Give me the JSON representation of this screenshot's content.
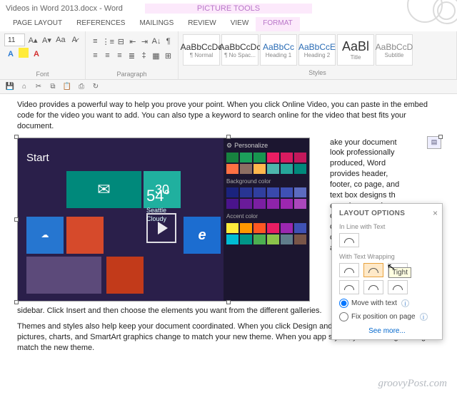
{
  "window": {
    "title": "Videos in Word 2013.docx - Word",
    "contextual_title": "PICTURE TOOLS"
  },
  "tabs": {
    "page_layout": "PAGE LAYOUT",
    "references": "REFERENCES",
    "mailings": "MAILINGS",
    "review": "REVIEW",
    "view": "VIEW",
    "format": "FORMAT"
  },
  "ribbon": {
    "font_size": "11",
    "group_font": "Font",
    "group_paragraph": "Paragraph",
    "group_styles": "Styles",
    "styles": [
      {
        "preview": "AaBbCcDc",
        "name": "¶ Normal"
      },
      {
        "preview": "AaBbCcDc",
        "name": "¶ No Spac..."
      },
      {
        "preview": "AaBbCc",
        "name": "Heading 1"
      },
      {
        "preview": "AaBbCcE",
        "name": "Heading 2"
      },
      {
        "preview": "AaBl",
        "name": "Title"
      },
      {
        "preview": "AaBbCcD",
        "name": "Subtitle"
      }
    ]
  },
  "doc": {
    "p1": "Video provides a powerful way to help you prove your point. When you click Online Video, you can paste in the embed code for the video you want to add. You can also type a keyword to search online for the video that best fits your document.",
    "wrap": "ake your document look professionally produced, Word provides header, footer, co page, and text box designs th compleme each othe For examp you can ac matching cover page header, an",
    "p2": "sidebar. Click Insert and then choose the elements you want from the different galleries.",
    "p3": "Themes and styles also help keep your document coordinated. When you click Design and choose a n Theme, the pictures, charts, and SmartArt graphics change to match your new theme. When you app styles, your headings change to match the new theme."
  },
  "media": {
    "start": "Start",
    "personalize": "Personalize",
    "temp": "54°",
    "city": "Seattle",
    "cond": "Cloudy",
    "date": "30"
  },
  "layout": {
    "title": "LAYOUT OPTIONS",
    "inline": "In Line with Text",
    "wrapping": "With Text Wrapping",
    "tooltip": "Tight",
    "move": "Move with text",
    "fix": "Fix position on page",
    "seemore": "See more..."
  },
  "watermark": "groovyPost.com"
}
